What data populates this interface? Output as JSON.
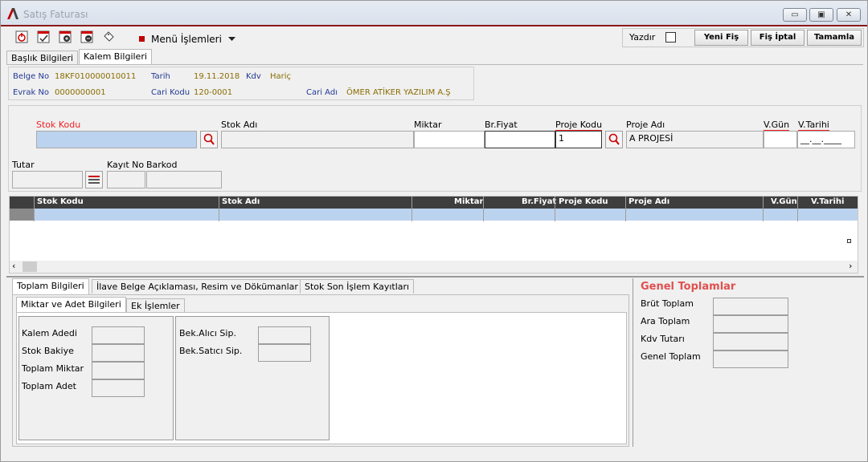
{
  "window": {
    "title": "Satış Faturası",
    "minimize": "▭",
    "maximize": "▣",
    "close": "✕"
  },
  "toolbar": {
    "menu_label": "Menü İşlemleri",
    "print_label": "Yazdır",
    "new_button": "Yeni Fiş",
    "cancel_button": "Fiş İptal",
    "complete_button": "Tamamla"
  },
  "tabs": [
    "Başlık Bilgileri",
    "Kalem Bilgileri"
  ],
  "header": {
    "belge_no_label": "Belge No",
    "belge_no": "18KF010000010011",
    "evrak_no_label": "Evrak No",
    "evrak_no": "0000000001",
    "tarih_label": "Tarih",
    "tarih": "19.11.2018",
    "kdv_label": "Kdv",
    "kdv": "Hariç",
    "cari_kodu_label": "Cari Kodu",
    "cari_kodu": "120-0001",
    "cari_adi_label": "Cari Adı",
    "cari_adi": "ÖMER ATİKER YAZILIM A.Ş"
  },
  "form": {
    "stok_kodu": "Stok Kodu",
    "stok_adi": "Stok Adı",
    "miktar": "Miktar",
    "br_fiyat": "Br.Fiyat",
    "proje_kodu": "Proje Kodu",
    "proje_kodu_value": "1",
    "proje_adi": "Proje Adı",
    "proje_adi_value": "A PROJESİ",
    "v_gun": "V.Gün",
    "v_tarihi": "V.Tarihi",
    "v_tarihi_value": "__.__.____",
    "tutar": "Tutar",
    "kayit_no": "Kayıt No",
    "barkod": "Barkod"
  },
  "grid_columns": [
    "Stok Kodu",
    "Stok Adı",
    "Miktar",
    "Br.Fiyat",
    "Proje Kodu",
    "Proje Adı",
    "V.Gün",
    "V.Tarihi"
  ],
  "bottom_tabs": [
    "Toplam Bilgileri",
    "İlave Belge Açıklaması, Resim ve Dökümanlar",
    "Stok Son İşlem Kayıtları"
  ],
  "sub_tabs": [
    "Miktar ve Adet Bilgileri",
    "Ek İşlemler"
  ],
  "totals_left": [
    "Kalem Adedi",
    "Stok Bakiye",
    "Toplam Miktar",
    "Toplam Adet"
  ],
  "totals_mid": [
    "Bek.Alıcı Sip.",
    "Bek.Satıcı Sip."
  ],
  "genel": {
    "title": "Genel Toplamlar",
    "labels": [
      "Brüt Toplam",
      "Ara Toplam",
      "Kdv Tutarı",
      "Genel Toplam"
    ]
  },
  "colors": {
    "accent_red": "#c00000",
    "selection_blue": "#bcd3ef",
    "header_dark": "#3e3e3e"
  }
}
